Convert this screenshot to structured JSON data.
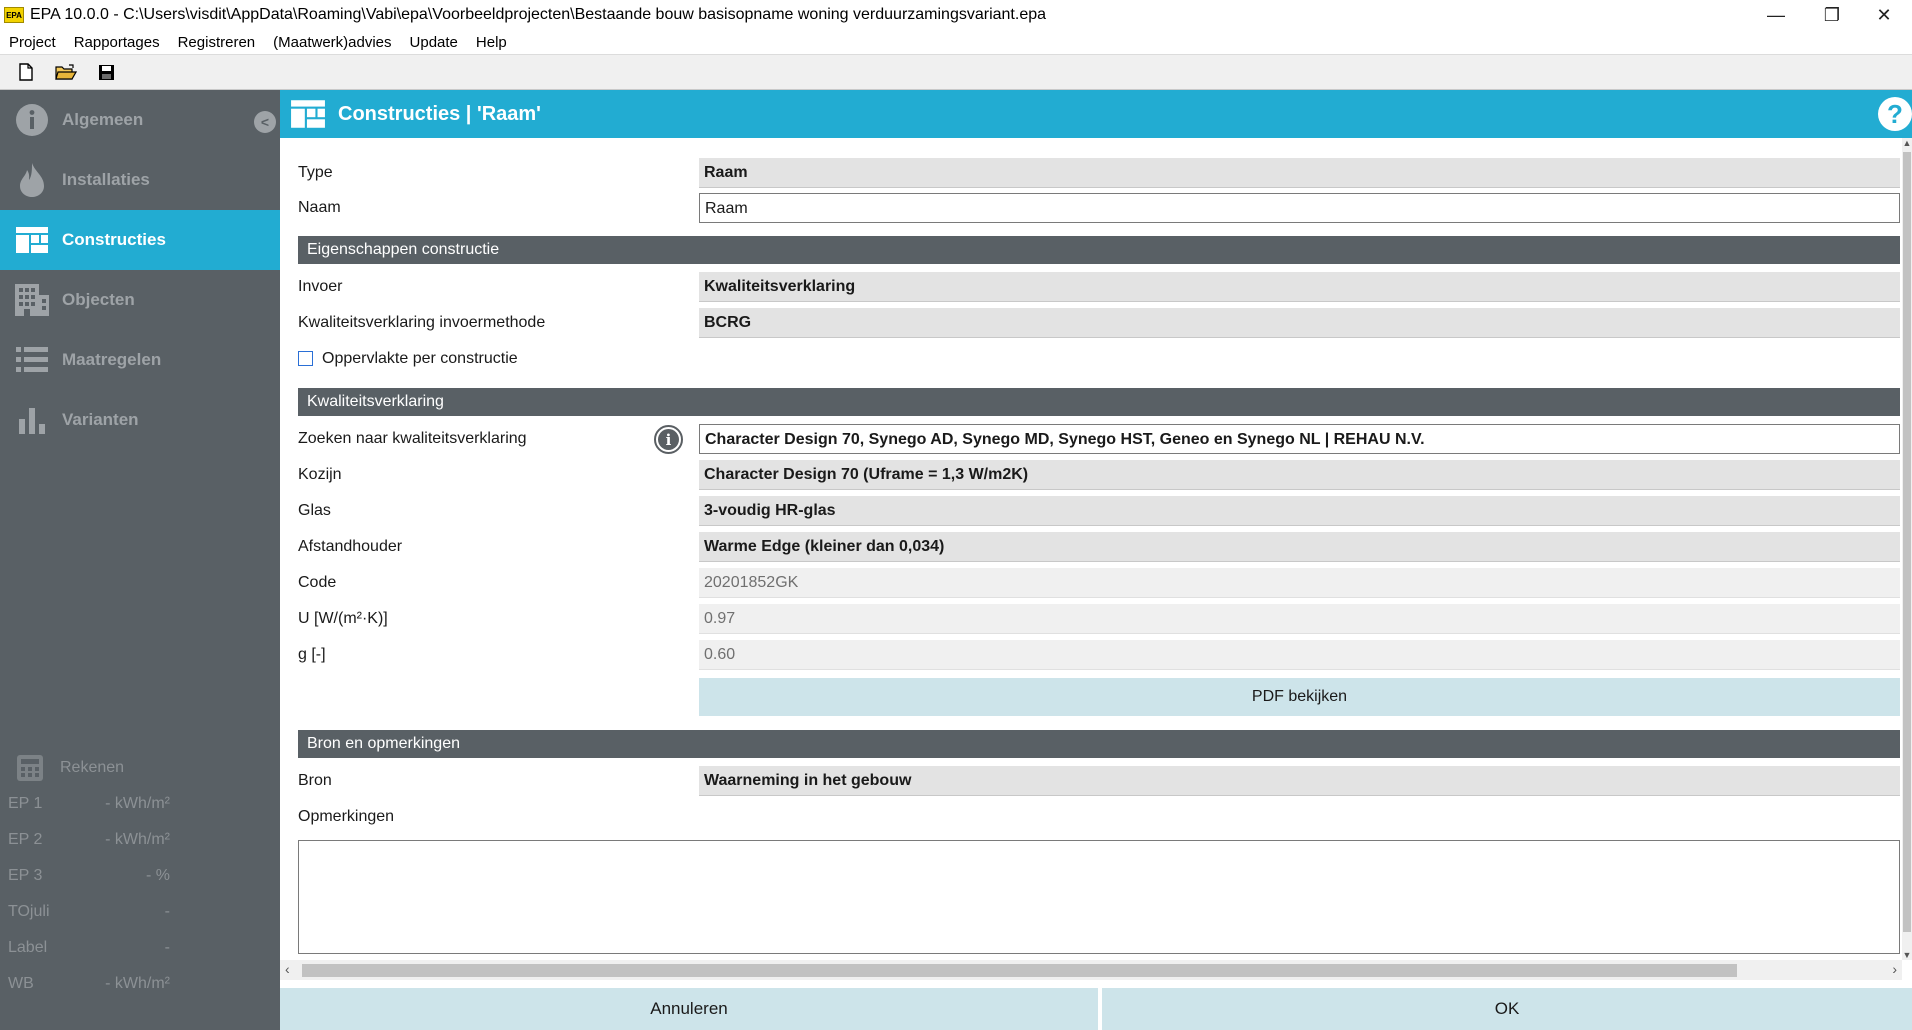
{
  "window": {
    "app_icon_text": "EPA",
    "title": "EPA 10.0.0 - C:\\Users\\visdit\\AppData\\Roaming\\Vabi\\epa\\Voorbeeldprojecten\\Bestaande bouw basisopname woning verduurzamingsvariant.epa",
    "minimize_glyph": "—",
    "maximize_glyph": "❐",
    "close_glyph": "✕"
  },
  "menu": [
    "Project",
    "Rapportages",
    "Registreren",
    "(Maatwerk)advies",
    "Update",
    "Help"
  ],
  "toolbar": {
    "new_icon": "new-file-icon",
    "open_icon": "open-folder-icon",
    "save_icon": "save-icon"
  },
  "sidebar": {
    "items": [
      {
        "label": "Algemeen",
        "icon": "info-icon"
      },
      {
        "label": "Installaties",
        "icon": "flame-icon"
      },
      {
        "label": "Constructies",
        "icon": "constructions-icon"
      },
      {
        "label": "Objecten",
        "icon": "building-icon"
      },
      {
        "label": "Maatregelen",
        "icon": "list-icon"
      },
      {
        "label": "Varianten",
        "icon": "bar-chart-icon"
      }
    ],
    "active_item": "Constructies",
    "collapse_glyph": "<",
    "calc": {
      "label": "Rekenen",
      "rows": [
        {
          "key": "EP 1",
          "value": "- kWh/m²"
        },
        {
          "key": "EP 2",
          "value": "- kWh/m²"
        },
        {
          "key": "EP 3",
          "value": "- %"
        },
        {
          "key": "TOjuli",
          "value": "-"
        },
        {
          "key": "Label",
          "value": "-"
        },
        {
          "key": "WB",
          "value": "- kWh/m²"
        }
      ]
    }
  },
  "header": {
    "title": "Constructies | 'Raam'",
    "help_glyph": "?"
  },
  "form": {
    "type_label": "Type",
    "type_value": "Raam",
    "naam_label": "Naam",
    "naam_value": "Raam",
    "section_eigenschappen": "Eigenschappen constructie",
    "invoer_label": "Invoer",
    "invoer_value": "Kwaliteitsverklaring",
    "methode_label": "Kwaliteitsverklaring invoermethode",
    "methode_value": "BCRG",
    "oppervlakte_label": "Oppervlakte per constructie",
    "section_kwaliteit": "Kwaliteitsverklaring",
    "zoeken_label": "Zoeken naar kwaliteitsverklaring",
    "zoeken_value": "Character Design 70, Synego AD, Synego MD, Synego HST, Geneo en Synego NL | REHAU N.V.",
    "info_glyph": "i",
    "kozijn_label": "Kozijn",
    "kozijn_value": "Character Design 70 (Uframe = 1,3 W/m2K)",
    "glas_label": "Glas",
    "glas_value": "3-voudig HR-glas",
    "afstandhouder_label": "Afstandhouder",
    "afstandhouder_value": "Warme Edge (kleiner dan 0,034)",
    "code_label": "Code",
    "code_value": "20201852GK",
    "u_label": "U [W/(m²·K)]",
    "u_value": "0.97",
    "g_label": "g [-]",
    "g_value": "0.60",
    "pdf_button": "PDF bekijken",
    "section_bron": "Bron en opmerkingen",
    "bron_label": "Bron",
    "bron_value": "Waarneming in het gebouw",
    "opmerkingen_label": "Opmerkingen",
    "opmerkingen_value": ""
  },
  "footer": {
    "cancel": "Annuleren",
    "ok": "OK"
  },
  "colors": {
    "accent": "#22acd2",
    "sidebar": "#596065",
    "section": "#596065",
    "button": "#cde4ea"
  }
}
